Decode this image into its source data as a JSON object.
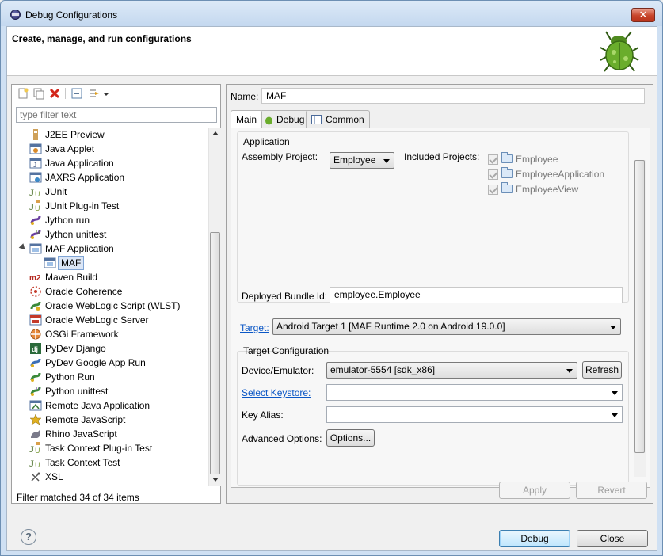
{
  "window": {
    "title": "Debug Configurations"
  },
  "banner": {
    "title": "Create, manage, and run configurations"
  },
  "filter": {
    "placeholder": "type filter text"
  },
  "tree": {
    "items": [
      {
        "label": "J2EE Preview",
        "icon": "j2ee-icon"
      },
      {
        "label": "Java Applet",
        "icon": "java-applet-icon"
      },
      {
        "label": "Java Application",
        "icon": "java-application-icon"
      },
      {
        "label": "JAXRS Application",
        "icon": "jaxrs-icon"
      },
      {
        "label": "JUnit",
        "icon": "junit-icon"
      },
      {
        "label": "JUnit Plug-in Test",
        "icon": "junit-plugin-icon"
      },
      {
        "label": "Jython run",
        "icon": "jython-icon"
      },
      {
        "label": "Jython unittest",
        "icon": "jython-unittest-icon"
      },
      {
        "label": "MAF Application",
        "icon": "maf-icon"
      },
      {
        "label": "MAF",
        "icon": "maf-config-icon"
      },
      {
        "label": "Maven Build",
        "icon": "maven-icon"
      },
      {
        "label": "Oracle Coherence",
        "icon": "coherence-icon"
      },
      {
        "label": "Oracle WebLogic Script (WLST)",
        "icon": "wlst-icon"
      },
      {
        "label": "Oracle WebLogic Server",
        "icon": "weblogic-icon"
      },
      {
        "label": "OSGi Framework",
        "icon": "osgi-icon"
      },
      {
        "label": "PyDev Django",
        "icon": "django-icon"
      },
      {
        "label": "PyDev Google App Run",
        "icon": "google-app-icon"
      },
      {
        "label": "Python Run",
        "icon": "python-icon"
      },
      {
        "label": "Python unittest",
        "icon": "python-unittest-icon"
      },
      {
        "label": "Remote Java Application",
        "icon": "remote-java-icon"
      },
      {
        "label": "Remote JavaScript",
        "icon": "remote-js-icon"
      },
      {
        "label": "Rhino JavaScript",
        "icon": "rhino-icon"
      },
      {
        "label": "Task Context Plug-in Test",
        "icon": "task-plugin-icon"
      },
      {
        "label": "Task Context Test",
        "icon": "task-test-icon"
      },
      {
        "label": "XSL",
        "icon": "xsl-icon"
      }
    ]
  },
  "status": "Filter matched 34 of 34 items",
  "name": {
    "label": "Name:",
    "value": "MAF"
  },
  "tabs": [
    "Main",
    "Debug",
    "Common"
  ],
  "application": {
    "group_label": "Application",
    "assembly_label": "Assembly Project:",
    "assembly_value": "Employee",
    "included_label": "Included Projects:",
    "projects": [
      "Employee",
      "EmployeeApplication",
      "EmployeeView"
    ],
    "bundle_label": "Deployed Bundle Id:",
    "bundle_value": "employee.Employee"
  },
  "target": {
    "label": "Target:",
    "value": "Android Target 1 [MAF Runtime 2.0 on Android 19.0.0]"
  },
  "target_config": {
    "group_label": "Target Configuration",
    "device_label": "Device/Emulator:",
    "device_value": "emulator-5554 [sdk_x86]",
    "refresh_label": "Refresh",
    "keystore_label": "Select Keystore:",
    "keystore_value": "",
    "alias_label": "Key Alias:",
    "alias_value": "",
    "advanced_label": "Advanced Options:",
    "options_label": "Options..."
  },
  "actions": {
    "apply": "Apply",
    "revert": "Revert",
    "debug": "Debug",
    "close": "Close"
  },
  "help_glyph": "?",
  "close_glyph": "✕",
  "colors": {
    "link": "#0b57c6",
    "selection": "#dbe6f6"
  }
}
